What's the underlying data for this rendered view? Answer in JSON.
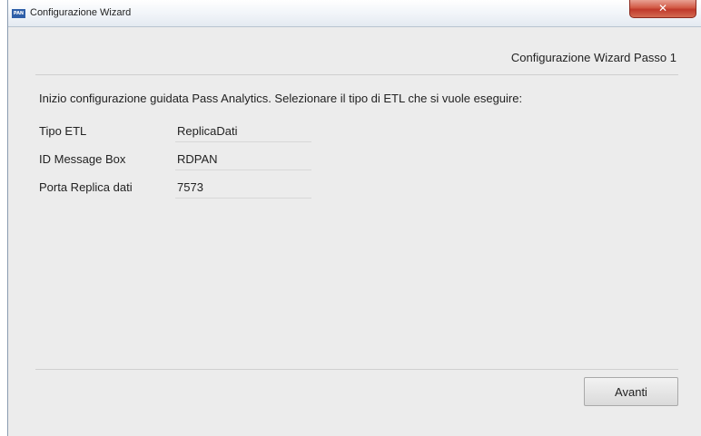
{
  "window": {
    "icon_text": "PAN",
    "title": "Configurazione Wizard",
    "close_symbol": "✕"
  },
  "wizard": {
    "step_title": "Configurazione Wizard Passo 1",
    "intro": "Inizio configurazione guidata Pass Analytics. Selezionare il tipo di ETL che si vuole eseguire:",
    "fields": [
      {
        "label": "Tipo ETL",
        "value": "ReplicaDati"
      },
      {
        "label": "ID Message Box",
        "value": "RDPAN"
      },
      {
        "label": "Porta Replica dati",
        "value": "7573"
      }
    ],
    "next_label": "Avanti"
  }
}
